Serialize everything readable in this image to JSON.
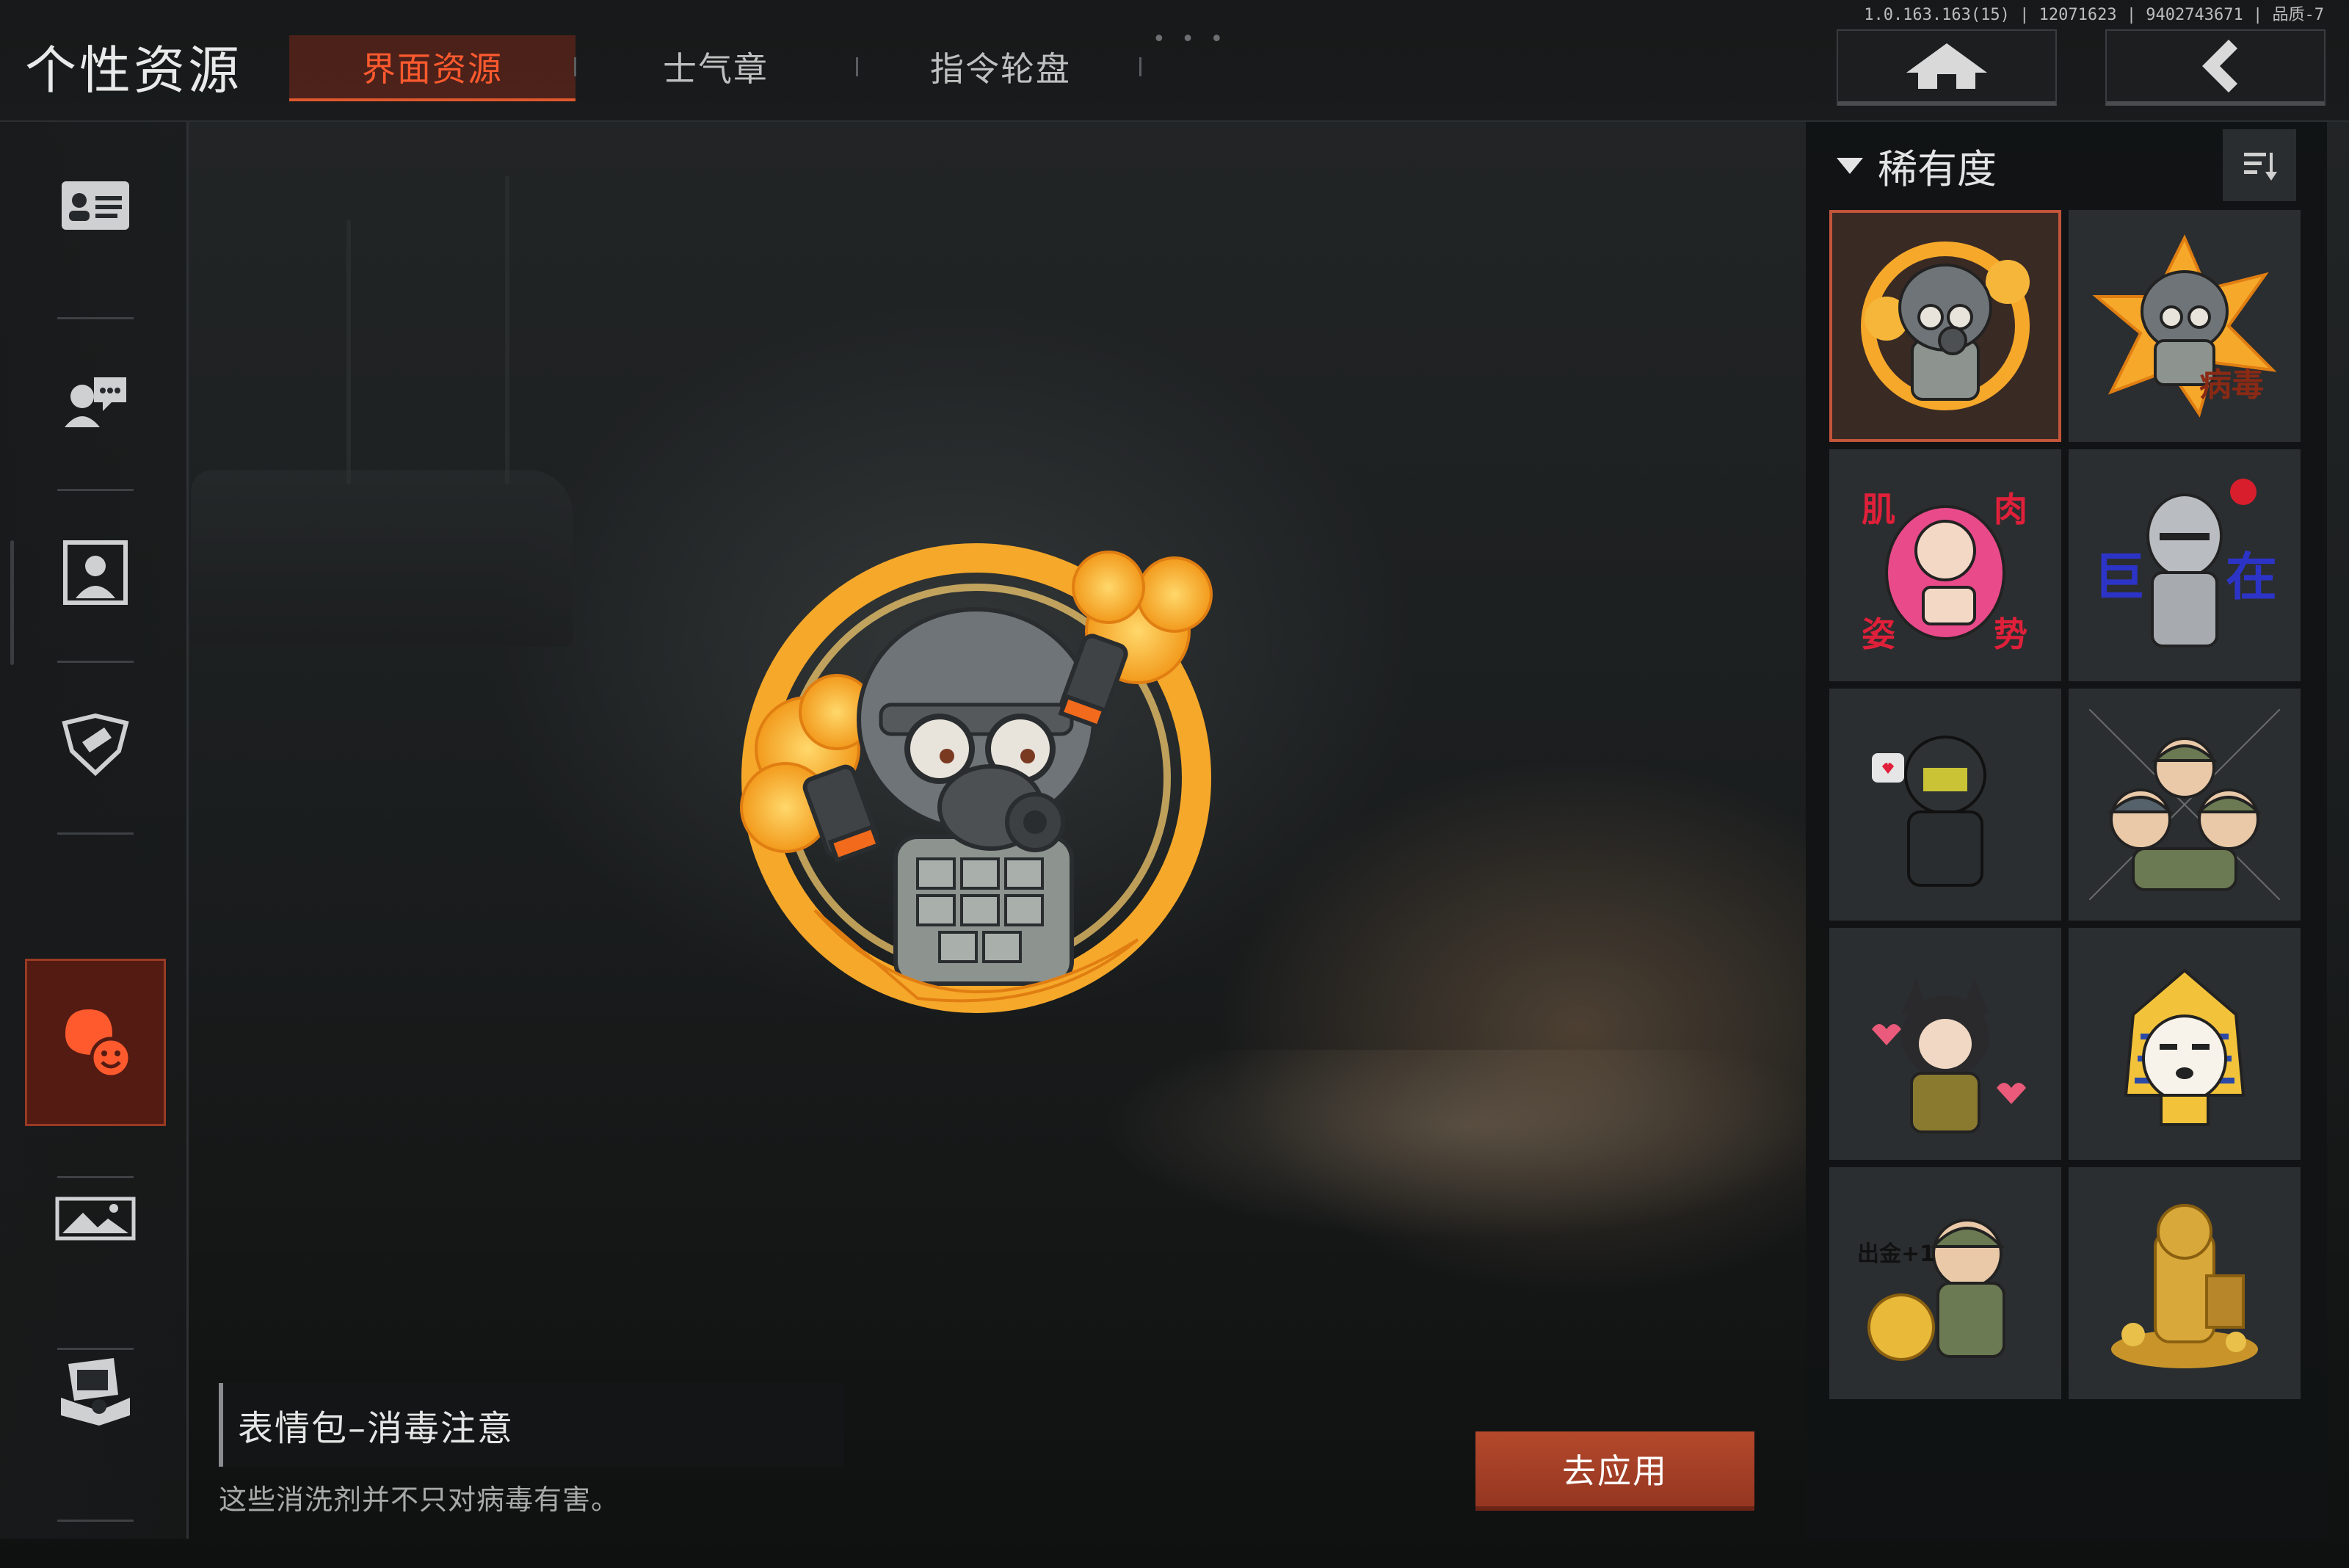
{
  "header": {
    "title": "个性资源",
    "tabs": [
      {
        "label": "界面资源",
        "active": true
      },
      {
        "label": "士气章",
        "active": false
      },
      {
        "label": "指令轮盘",
        "active": false
      }
    ],
    "version": "1.0.163.163(15) | 12071623 | 9402743671 | 品质-7",
    "home_icon": "home-icon",
    "back_icon": "back-icon"
  },
  "sidebar": {
    "items": [
      {
        "icon": "id-card-icon"
      },
      {
        "icon": "chat-avatar-icon"
      },
      {
        "icon": "portrait-frame-icon"
      },
      {
        "icon": "badge-shield-icon"
      },
      {
        "icon": "emoji-sticker-icon",
        "active": true
      },
      {
        "icon": "image-banner-icon"
      },
      {
        "icon": "device-kit-icon"
      }
    ]
  },
  "detail": {
    "name": "表情包–消毒注意",
    "description": "这些消洗剂并不只对病毒有害。",
    "apply_label": "去应用"
  },
  "filter": {
    "label": "稀有度",
    "sort_icon": "sort-icon"
  },
  "stickers": [
    {
      "name": "gas-mask-soldier",
      "selected": true,
      "text": ""
    },
    {
      "name": "gas-mask-soldier-boom",
      "selected": false,
      "text": "病毒"
    },
    {
      "name": "pink-girl",
      "selected": false,
      "text": "肌肉姿势"
    },
    {
      "name": "knight-rose",
      "selected": false,
      "text": "巨在"
    },
    {
      "name": "masked-operator",
      "selected": false,
      "text": ""
    },
    {
      "name": "three-soldiers",
      "selected": false,
      "text": ""
    },
    {
      "name": "cat-girl",
      "selected": false,
      "text": ""
    },
    {
      "name": "pharaoh-dog",
      "selected": false,
      "text": ""
    },
    {
      "name": "soldier-gold",
      "selected": false,
      "text": "出金+1"
    },
    {
      "name": "gold-statue",
      "selected": false,
      "text": ""
    }
  ],
  "colors": {
    "accent": "#e0582e",
    "active_tab_text": "#ff5a2e",
    "apply_button": "#a9412a"
  }
}
